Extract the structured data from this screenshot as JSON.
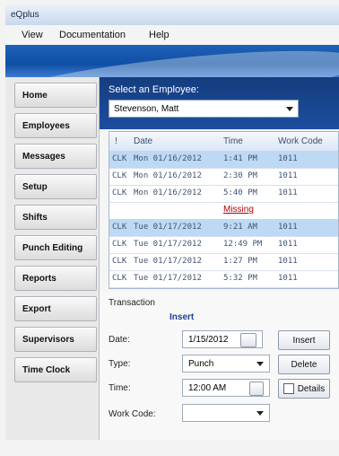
{
  "app": {
    "title": "eQplus",
    "menu": [
      "View",
      "Documentation",
      "Help"
    ]
  },
  "sidebar": {
    "items": [
      {
        "label": "Home"
      },
      {
        "label": "Employees"
      },
      {
        "label": "Messages"
      },
      {
        "label": "Setup"
      },
      {
        "label": "Shifts"
      },
      {
        "label": "Punch Editing"
      },
      {
        "label": "Reports"
      },
      {
        "label": "Export"
      },
      {
        "label": "Supervisors"
      },
      {
        "label": "Time Clock"
      }
    ]
  },
  "employee": {
    "label": "Select an Employee:",
    "selected": "Stevenson, Matt"
  },
  "grid": {
    "headers": [
      "!",
      "Date",
      "Time",
      "Work Code"
    ],
    "rows": [
      {
        "flag": "CLK",
        "date": "Mon 01/16/2012",
        "time": "1:41 PM",
        "work_code": "1011",
        "selected": true
      },
      {
        "flag": "CLK",
        "date": "Mon 01/16/2012",
        "time": "2:30 PM",
        "work_code": "1011",
        "selected": false
      },
      {
        "flag": "CLK",
        "date": "Mon 01/16/2012",
        "time": "5:40 PM",
        "work_code": "1011",
        "selected": false
      },
      {
        "flag": "",
        "date": "",
        "time": "Missing",
        "work_code": "",
        "selected": false,
        "missing": true
      },
      {
        "flag": "CLK",
        "date": "Tue 01/17/2012",
        "time": "9:21 AM",
        "work_code": "1011",
        "selected": true
      },
      {
        "flag": "CLK",
        "date": "Tue 01/17/2012",
        "time": "12:49 PM",
        "work_code": "1011",
        "selected": false
      },
      {
        "flag": "CLK",
        "date": "Tue 01/17/2012",
        "time": "1:27 PM",
        "work_code": "1011",
        "selected": false
      },
      {
        "flag": "CLK",
        "date": "Tue 01/17/2012",
        "time": "5:32 PM",
        "work_code": "1011",
        "selected": false
      }
    ]
  },
  "transaction": {
    "title": "Transaction",
    "mode": "Insert",
    "date_label": "Date:",
    "date_value": "1/15/2012",
    "type_label": "Type:",
    "type_value": "Punch",
    "time_label": "Time:",
    "time_value": "12:00 AM",
    "work_code_label": "Work Code:",
    "work_code_value": "",
    "buttons": {
      "insert": "Insert",
      "delete": "Delete",
      "details": "Details"
    }
  }
}
